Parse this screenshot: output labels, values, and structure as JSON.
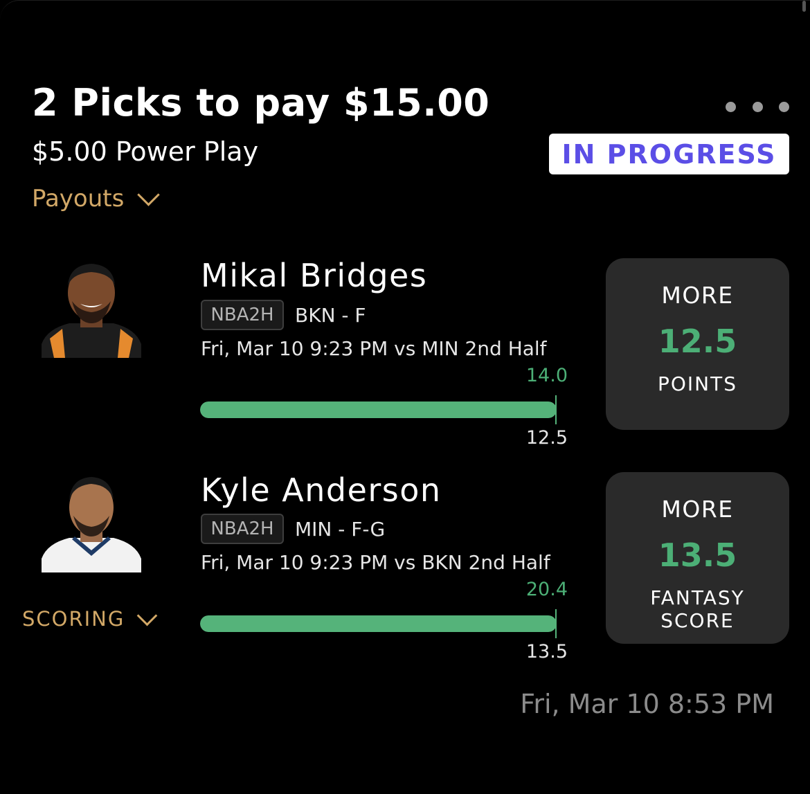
{
  "entry": {
    "title": "2 Picks to pay $15.00",
    "subtitle": "$5.00 Power Play",
    "status": "IN PROGRESS",
    "payouts_label": "Payouts",
    "scoring_label": "SCORING",
    "created_time": "Fri, Mar 10 8:53 PM"
  },
  "picks": [
    {
      "player_name": "Mikal Bridges",
      "league": "NBA2H",
      "team_pos": "BKN - F",
      "game_info": "Fri, Mar 10 9:23 PM  vs MIN 2nd Half",
      "current_value": "14.0",
      "line_value": "12.5",
      "progress": 1.0,
      "direction": "MORE",
      "stat_line": "12.5",
      "stat_name": "POINTS",
      "jersey_color": "#1d1d1d",
      "accent_color": "#e58a2e"
    },
    {
      "player_name": "Kyle Anderson",
      "league": "NBA2H",
      "team_pos": "MIN - F-G",
      "game_info": "Fri, Mar 10 9:23 PM  vs BKN 2nd Half",
      "current_value": "20.4",
      "line_value": "13.5",
      "progress": 1.0,
      "direction": "MORE",
      "stat_line": "13.5",
      "stat_name": "FANTASY\nSCORE",
      "jersey_color": "#f2f2f2",
      "accent_color": "#1f3b66"
    }
  ],
  "colors": {
    "accent_gold": "#d2a867",
    "success_green": "#55b37a",
    "badge_purple": "#5b4ee6"
  }
}
